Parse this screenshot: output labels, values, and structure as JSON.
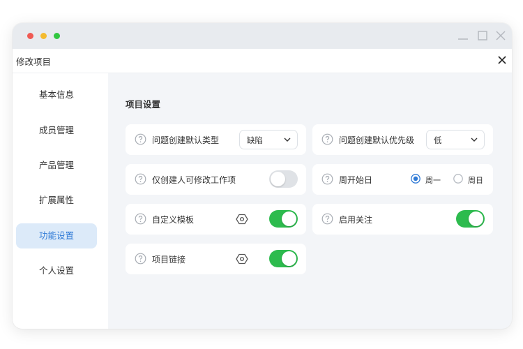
{
  "window": {
    "header_title": "修改项目"
  },
  "sidebar": {
    "items": [
      {
        "label": "基本信息",
        "active": false
      },
      {
        "label": "成员管理",
        "active": false
      },
      {
        "label": "产品管理",
        "active": false
      },
      {
        "label": "扩展属性",
        "active": false
      },
      {
        "label": "功能设置",
        "active": true
      },
      {
        "label": "个人设置",
        "active": false
      }
    ]
  },
  "main": {
    "section_title": "项目设置",
    "settings": {
      "default_type": {
        "label": "问题创建默认类型",
        "value": "缺陷"
      },
      "default_priority": {
        "label": "问题创建默认优先级",
        "value": "低"
      },
      "creator_only_edit": {
        "label": "仅创建人可修改工作项",
        "enabled": false
      },
      "week_start": {
        "label": "周开始日",
        "options": [
          "周一",
          "周日"
        ],
        "selected": "周一"
      },
      "custom_template": {
        "label": "自定义模板",
        "enabled": true
      },
      "enable_follow": {
        "label": "启用关注",
        "enabled": true
      },
      "project_link": {
        "label": "项目链接",
        "enabled": true
      }
    }
  },
  "colors": {
    "accent": "#2f7ad6",
    "toggle_on": "#2dbb4e",
    "toggle_off": "#dfe2e6",
    "active_item_bg": "#dceaf9"
  },
  "icons": {
    "help": "question-circle-icon",
    "settings": "hexagon-gear-icon",
    "dropdown": "chevron-down-icon"
  }
}
